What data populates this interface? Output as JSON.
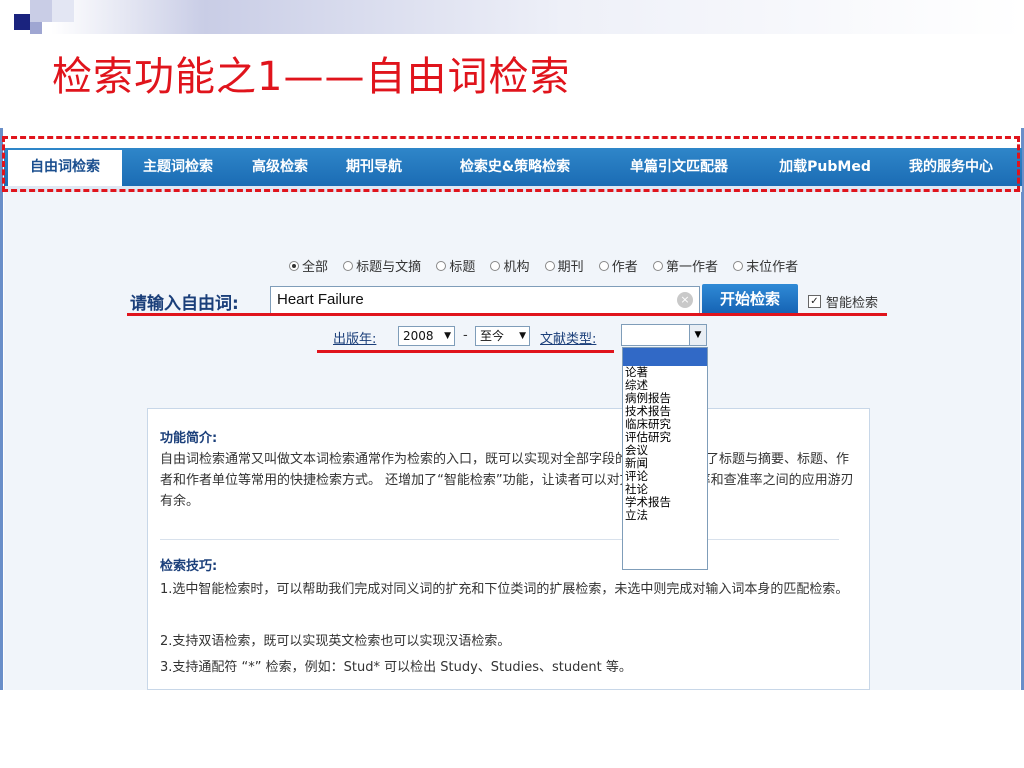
{
  "slide": {
    "title": "检索功能之1——自由词检索",
    "colors": {
      "title": "#e0141c",
      "nav": "#1b6cb4",
      "highlight": "#e0141c"
    }
  },
  "nav": {
    "tabs": [
      {
        "label": "自由词检索",
        "active": true
      },
      {
        "label": "主题词检索"
      },
      {
        "label": "高级检索"
      },
      {
        "label": "期刊导航"
      },
      {
        "label": "检索史&策略检索"
      },
      {
        "label": "单篇引文匹配器"
      },
      {
        "label": "加载PubMed"
      },
      {
        "label": "我的服务中心"
      }
    ]
  },
  "search": {
    "scopes": [
      {
        "label": "全部",
        "selected": true
      },
      {
        "label": "标题与文摘"
      },
      {
        "label": "标题"
      },
      {
        "label": "机构"
      },
      {
        "label": "期刊"
      },
      {
        "label": "作者"
      },
      {
        "label": "第一作者"
      },
      {
        "label": "末位作者"
      }
    ],
    "label": "请输入自由词:",
    "query": "Heart Failure",
    "clear_icon": "×",
    "submit": "开始检索",
    "smart_checkbox": "智能检索",
    "smart_checked": true
  },
  "filters": {
    "year_label": "出版年:",
    "year_from": "2008",
    "dash": "-",
    "year_to": "至今",
    "type_label": "文献类型:",
    "type_options": [
      "论著",
      "综述",
      "病例报告",
      "技术报告",
      "临床研究",
      "评估研究",
      "会议",
      "新闻",
      "评论",
      "社论",
      "学术报告",
      "立法"
    ]
  },
  "info": {
    "intro_title": "功能简介:",
    "intro_text": "自由词检索通常又叫做文本词检索通常作为检索的入口，既可以实现对全部字段的检索，还设置了标题与摘要、标题、作者和作者单位等常用的快捷检索方式。 还增加了“智能检索”功能，让读者可以对文献检索查全率和查准率之间的应用游刃有余。",
    "tips_title": "检索技巧:",
    "tip1": "1.选中智能检索时，可以帮助我们完成对同义词的扩充和下位类词的扩展检索，未选中则完成对输入词本身的匹配检索。",
    "tip2": "2.支持双语检索，既可以实现英文检索也可以实现汉语检索。",
    "tip3": "3.支持通配符 “*” 检索，例如：Stud* 可以检出 Study、Studies、student 等。"
  }
}
